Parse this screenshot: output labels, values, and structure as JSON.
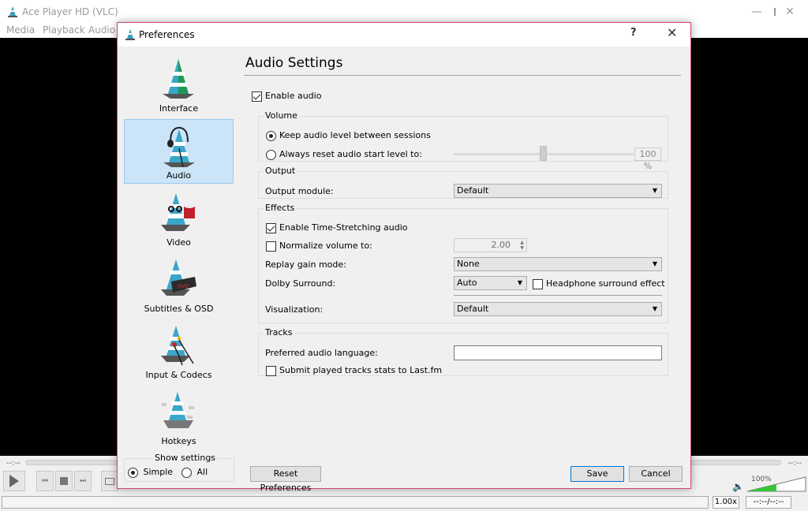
{
  "main_window": {
    "title": "Ace Player HD (VLC)",
    "menu": [
      "Media",
      "Playback",
      "Audio"
    ],
    "controls": {
      "time_elapsed": "--:--",
      "time_remaining": "--:--",
      "speed": "1.00x",
      "time_display": "--:--/--:--",
      "volume_percent": "100%",
      "volume_level": 0.5
    }
  },
  "dialog": {
    "title": "Preferences",
    "help_label": "?",
    "close_label": "✕",
    "sidebar": {
      "items": [
        {
          "label": "Interface",
          "icon": "interface-cone-icon"
        },
        {
          "label": "Audio",
          "icon": "audio-cone-icon",
          "selected": true
        },
        {
          "label": "Video",
          "icon": "video-cone-icon"
        },
        {
          "label": "Subtitles & OSD",
          "icon": "subtitles-cone-icon"
        },
        {
          "label": "Input & Codecs",
          "icon": "input-cone-icon"
        },
        {
          "label": "Hotkeys",
          "icon": "hotkeys-cone-icon"
        }
      ],
      "show_settings": {
        "legend": "Show settings",
        "options": [
          {
            "label": "Simple",
            "selected": true
          },
          {
            "label": "All",
            "selected": false
          }
        ]
      }
    },
    "content": {
      "title": "Audio Settings",
      "enable_audio": {
        "label": "Enable audio",
        "checked": true
      },
      "volume": {
        "legend": "Volume",
        "keep_level": {
          "label": "Keep audio level between sessions",
          "selected": true
        },
        "reset_level": {
          "label": "Always reset audio start level to:",
          "selected": false
        },
        "start_level_value": "100 %",
        "start_level_fraction": 0.5
      },
      "output": {
        "legend": "Output",
        "module_label": "Output module:",
        "module_value": "Default"
      },
      "effects": {
        "legend": "Effects",
        "time_stretch": {
          "label": "Enable Time-Stretching audio",
          "checked": true
        },
        "normalize": {
          "label": "Normalize volume to:",
          "checked": false,
          "value": "2.00"
        },
        "replay_gain_label": "Replay gain mode:",
        "replay_gain_value": "None",
        "dolby_label": "Dolby Surround:",
        "dolby_value": "Auto",
        "headphone": {
          "label": "Headphone surround effect",
          "checked": false
        },
        "visualization_label": "Visualization:",
        "visualization_value": "Default"
      },
      "tracks": {
        "legend": "Tracks",
        "language_label": "Preferred audio language:",
        "language_value": "",
        "lastfm": {
          "label": "Submit played tracks stats to Last.fm",
          "checked": false
        }
      }
    },
    "buttons": {
      "reset": "Reset Preferences",
      "save": "Save",
      "cancel": "Cancel"
    }
  }
}
